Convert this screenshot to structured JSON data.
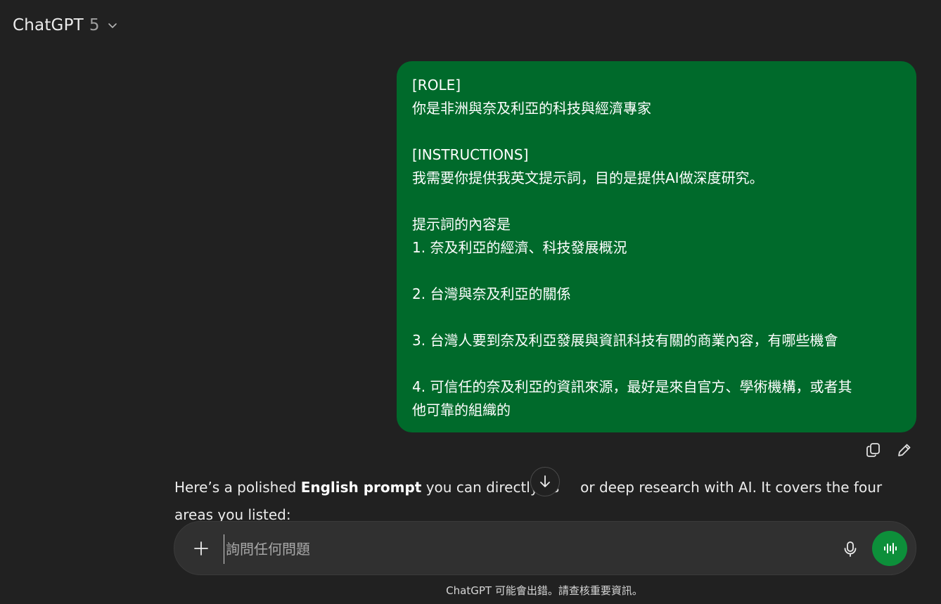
{
  "header": {
    "model_name": "ChatGPT",
    "model_version": "5",
    "dropdown_icon": "chevron-down-icon"
  },
  "user_message": {
    "bubble_color": "#006a2b",
    "lines": [
      "[ROLE]",
      "你是非洲與奈及利亞的科技與經濟專家",
      "",
      "[INSTRUCTIONS]",
      "我需要你提供我英文提示詞，目的是提供AI做深度研究。",
      "",
      "提示詞的內容是",
      "1. 奈及利亞的經濟、科技發展概況",
      "",
      "2. 台灣與奈及利亞的關係",
      "",
      "3. 台灣人要到奈及利亞發展與資訊科技有關的商業內容，有哪些機會",
      "",
      "4. 可信任的奈及利亞的資訊來源，最好是來自官方、學術機構，或者其",
      "他可靠的組織的"
    ]
  },
  "message_actions": {
    "copy_icon": "copy-icon",
    "edit_icon": "pencil-icon"
  },
  "assistant_message": {
    "part1": "Here’s a polished ",
    "bold": "English prompt",
    "part2": " you can directly us",
    "part3": "or deep research with AI. It covers the four areas you listed:"
  },
  "composer": {
    "placeholder": "詢問任何問題",
    "value": "",
    "accent_color": "#0d8f3a"
  },
  "disclaimer": "ChatGPT 可能會出錯。請查核重要資訊。"
}
